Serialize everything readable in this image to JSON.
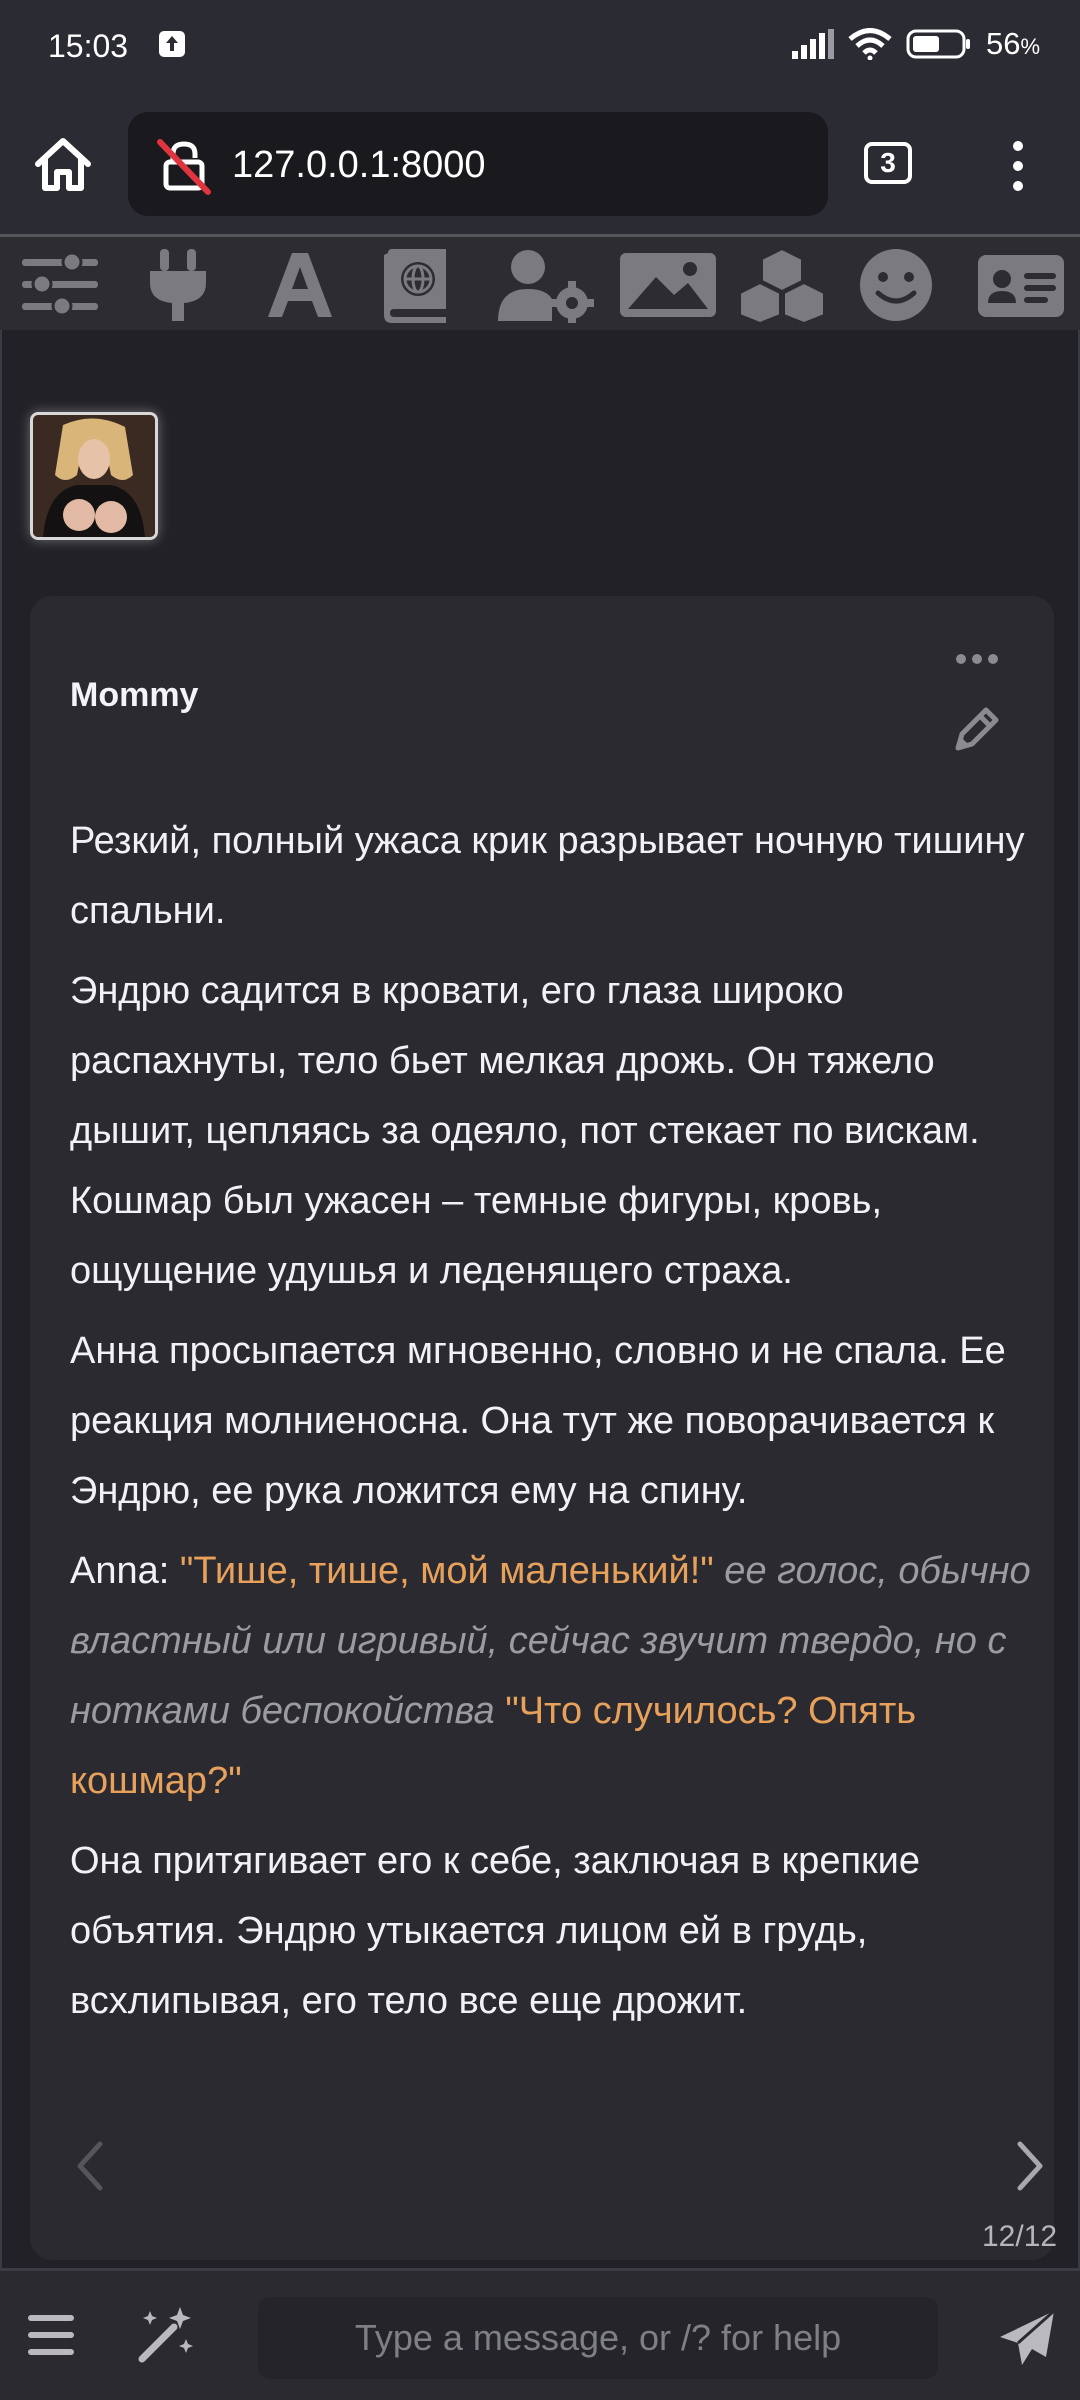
{
  "status": {
    "time": "15:03",
    "battery": "56",
    "battery_unit": "%"
  },
  "browser": {
    "url": "127.0.0.1:8000",
    "tab_count": "3"
  },
  "toolbar": {
    "icons": [
      "sliders-icon",
      "plug-icon",
      "font-icon",
      "book-globe-icon",
      "user-gear-icon",
      "image-icon",
      "cubes-icon",
      "smiley-icon",
      "contact-card-icon"
    ]
  },
  "message": {
    "name": "Mommy",
    "p1": "Резкий, полный ужаса крик разрывает ночную тишину спальни.",
    "p2": "Эндрю садится в кровати, его глаза широко распахнуты, тело бьет мелкая дрожь. Он тяжело дышит, цепляясь за одеяло, пот стекает по вискам. Кошмар был ужасен – темные фигуры, кровь, ощущение удушья и леденящего страха.",
    "p3": "Анна просыпается мгновенно, словно и не спала. Ее реакция молниеносна. Она тут же поворачивается к Эндрю, ее рука ложится ему на спину.",
    "p4_speaker": "Anna: ",
    "p4_quote1": "\"Тише, тише, мой маленький!\"",
    "p4_narration": " ее голос, обычно властный или игривый, сейчас звучит твердо, но с нотками беспокойства ",
    "p4_quote2": "\"Что случилось? Опять кошмар?\"",
    "p5": "Она притягивает его к себе, заключая в крепкие объятия. Эндрю утыкается лицом ей в грудь, всхлипывая, его тело все еще дрожит.",
    "counter": "12/12"
  },
  "composer": {
    "placeholder": "Type a message, or /? for help"
  },
  "colors": {
    "quote": "#e8a15a",
    "narration": "#9b9ba2",
    "background": "#1b1b21"
  }
}
